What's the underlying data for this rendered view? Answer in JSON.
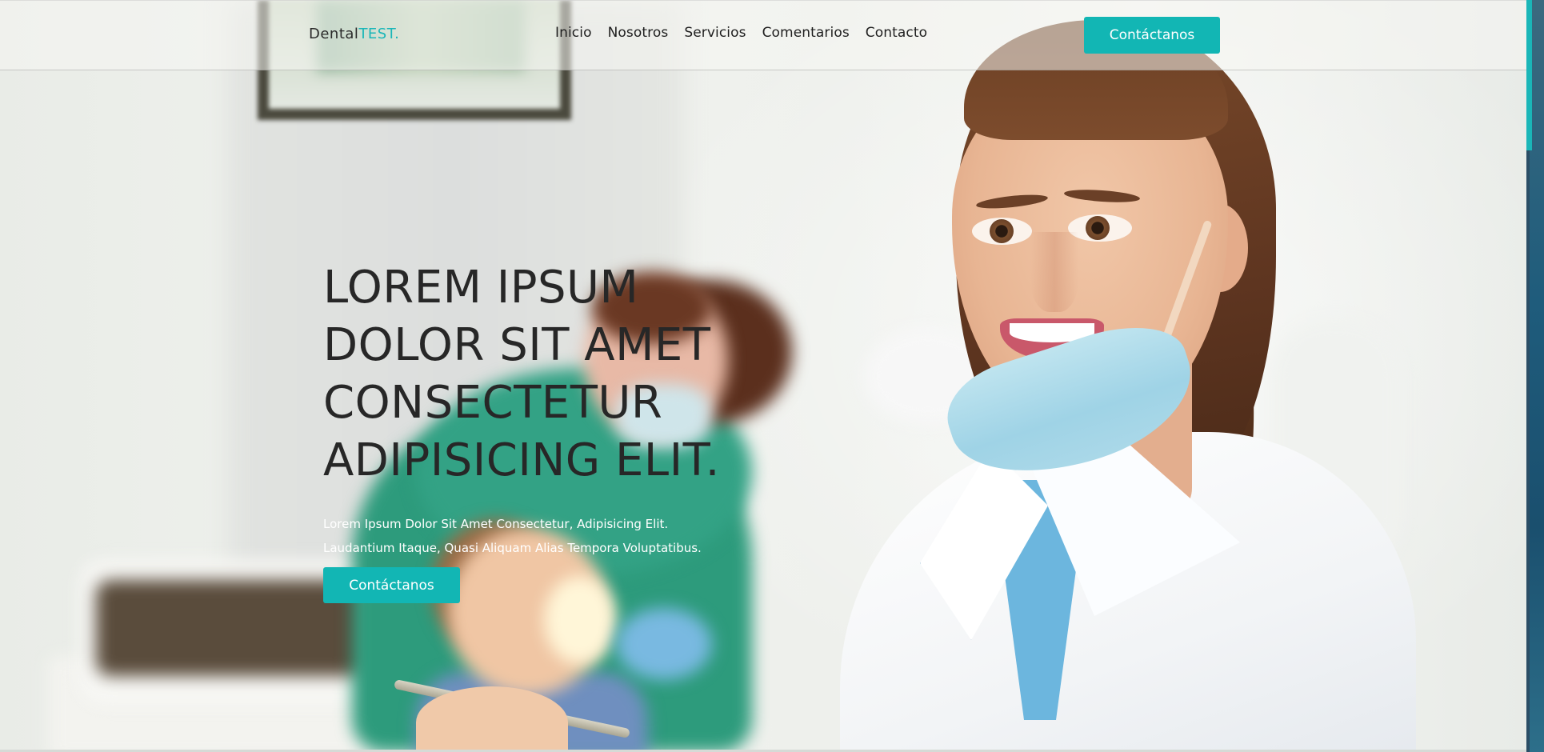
{
  "header": {
    "logo": {
      "main": "Dental",
      "accent": "TEST."
    },
    "nav": [
      {
        "label": "Inicio"
      },
      {
        "label": "Nosotros"
      },
      {
        "label": "Servicios"
      },
      {
        "label": "Comentarios"
      },
      {
        "label": "Contacto"
      }
    ],
    "cta_label": "Contáctanos"
  },
  "hero": {
    "title_lines": [
      "LOREM IPSUM",
      "DOLOR SIT AMET",
      "CONSECTETUR",
      "ADIPISICING ELIT."
    ],
    "subtitle_lines": [
      "Lorem Ipsum Dolor Sit Amet Consectetur, Adipisicing Elit.",
      "Laudantium Itaque, Quasi Aliquam Alias Tempora Voluptatibus."
    ],
    "cta_label": "Contáctanos"
  },
  "colors": {
    "accent": "#12b6b4",
    "title_text": "#272727",
    "subtitle_text": "#ffffff"
  }
}
